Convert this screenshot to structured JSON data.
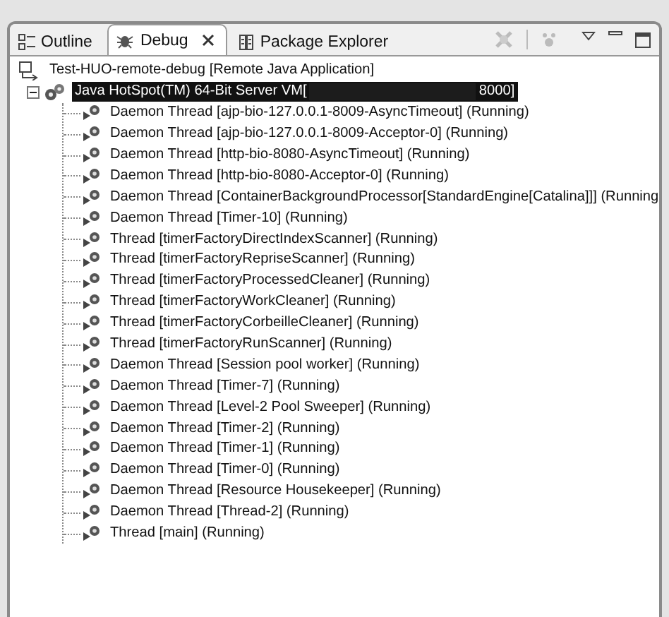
{
  "tabs": [
    {
      "label": "Outline",
      "kind": "outline",
      "selected": false
    },
    {
      "label": "Debug",
      "kind": "debug",
      "selected": true
    },
    {
      "label": "Package Explorer",
      "kind": "package",
      "selected": false
    }
  ],
  "launch": {
    "label": "Test-HUO-remote-debug [Remote Java Application]",
    "children": [
      {
        "label": "Java HotSpot(TM) 64-Bit Server VM[",
        "label_end": "8000]",
        "redacted": true,
        "selected": true,
        "expanded": true,
        "children": [
          {
            "label": "Daemon Thread [ajp-bio-127.0.0.1-8009-AsyncTimeout] (Running)"
          },
          {
            "label": "Daemon Thread [ajp-bio-127.0.0.1-8009-Acceptor-0] (Running)"
          },
          {
            "label": "Daemon Thread [http-bio-8080-AsyncTimeout] (Running)"
          },
          {
            "label": "Daemon Thread [http-bio-8080-Acceptor-0] (Running)"
          },
          {
            "label": "Daemon Thread [ContainerBackgroundProcessor[StandardEngine[Catalina]]] (Running"
          },
          {
            "label": "Daemon Thread [Timer-10] (Running)"
          },
          {
            "label": "Thread [timerFactoryDirectIndexScanner] (Running)"
          },
          {
            "label": "Thread [timerFactoryRepriseScanner] (Running)"
          },
          {
            "label": "Thread [timerFactoryProcessedCleaner] (Running)"
          },
          {
            "label": "Thread [timerFactoryWorkCleaner] (Running)"
          },
          {
            "label": "Thread [timerFactoryCorbeilleCleaner] (Running)"
          },
          {
            "label": "Thread [timerFactoryRunScanner] (Running)"
          },
          {
            "label": "Daemon Thread [Session pool worker] (Running)"
          },
          {
            "label": "Daemon Thread [Timer-7] (Running)"
          },
          {
            "label": "Daemon Thread [Level-2 Pool Sweeper] (Running)"
          },
          {
            "label": "Daemon Thread [Timer-2] (Running)"
          },
          {
            "label": "Daemon Thread [Timer-1] (Running)"
          },
          {
            "label": "Daemon Thread [Timer-0] (Running)"
          },
          {
            "label": "Daemon Thread [Resource Housekeeper] (Running)"
          },
          {
            "label": "Daemon Thread [Thread-2] (Running)"
          },
          {
            "label": "Thread [main] (Running)"
          }
        ]
      }
    ]
  }
}
